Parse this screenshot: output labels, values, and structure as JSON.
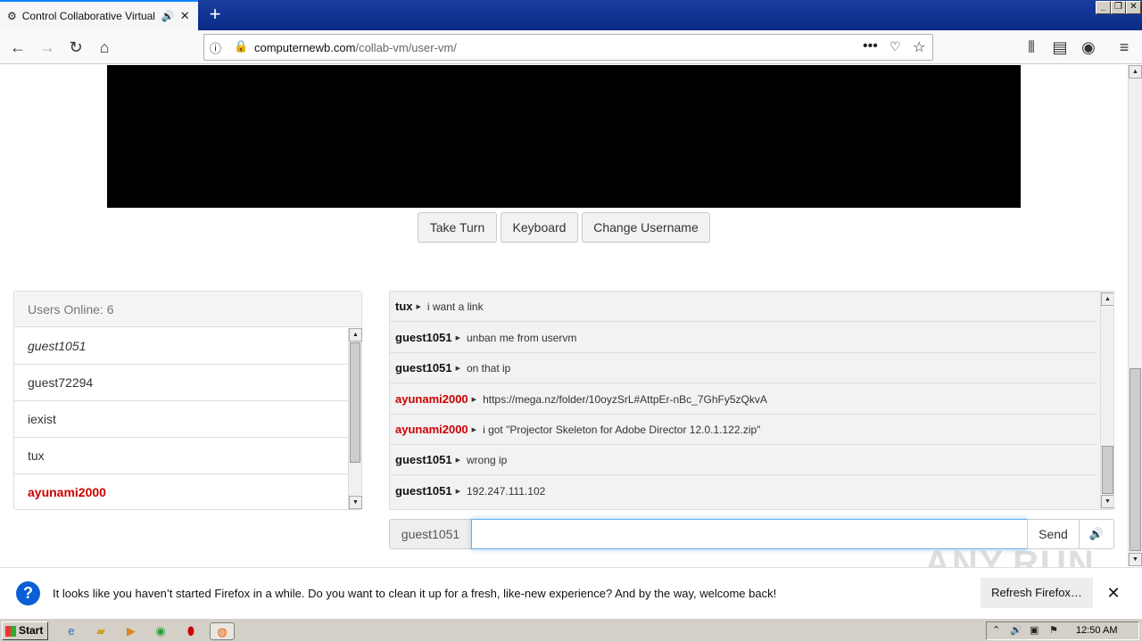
{
  "browser": {
    "tab_title": "Control Collaborative Virtual M",
    "new_tab_symbol": "+",
    "url_host": "computernewb.com",
    "url_path": "/collab-vm/user-vm/",
    "window_controls": [
      "_",
      "❐",
      "✕"
    ]
  },
  "vm": {
    "buttons": {
      "take_turn": "Take Turn",
      "keyboard": "Keyboard",
      "change_username": "Change Username"
    }
  },
  "users": {
    "header": "Users Online: 6",
    "list": [
      {
        "name": "guest1051",
        "style": "italic"
      },
      {
        "name": "guest72294",
        "style": "normal"
      },
      {
        "name": "iexist",
        "style": "normal"
      },
      {
        "name": "tux",
        "style": "normal"
      },
      {
        "name": "ayunami2000",
        "style": "admin"
      }
    ]
  },
  "chat": {
    "messages": [
      {
        "user": "tux",
        "text": "i want a link",
        "admin": false
      },
      {
        "user": "guest1051",
        "text": "unban me from uservm",
        "admin": false
      },
      {
        "user": "guest1051",
        "text": "on that ip",
        "admin": false
      },
      {
        "user": "ayunami2000",
        "text": "https://mega.nz/folder/10oyzSrL#AttpEr-nBc_7GhFy5zQkvA",
        "admin": true
      },
      {
        "user": "ayunami2000",
        "text": "i got \"Projector Skeleton for Adobe Director 12.0.1.122.zip\"",
        "admin": true
      },
      {
        "user": "guest1051",
        "text": "wrong ip",
        "admin": false
      },
      {
        "user": "guest1051",
        "text": "192.247.111.102",
        "admin": false
      }
    ],
    "username": "guest1051",
    "input_value": "",
    "send_label": "Send",
    "volume_icon": "🔊"
  },
  "notification": {
    "text": "It looks like you haven’t started Firefox in a while. Do you want to clean it up for a fresh, like-new experience? And by the way, welcome back!",
    "button": "Refresh Firefox…",
    "close": "✕"
  },
  "watermark": "ANY.RUN",
  "taskbar": {
    "start_label": "Start",
    "clock": "12:50 AM"
  },
  "colors": {
    "admin_name": "#cc0000",
    "focus_border": "#66afe9",
    "info_blue": "#0b5fd6"
  }
}
